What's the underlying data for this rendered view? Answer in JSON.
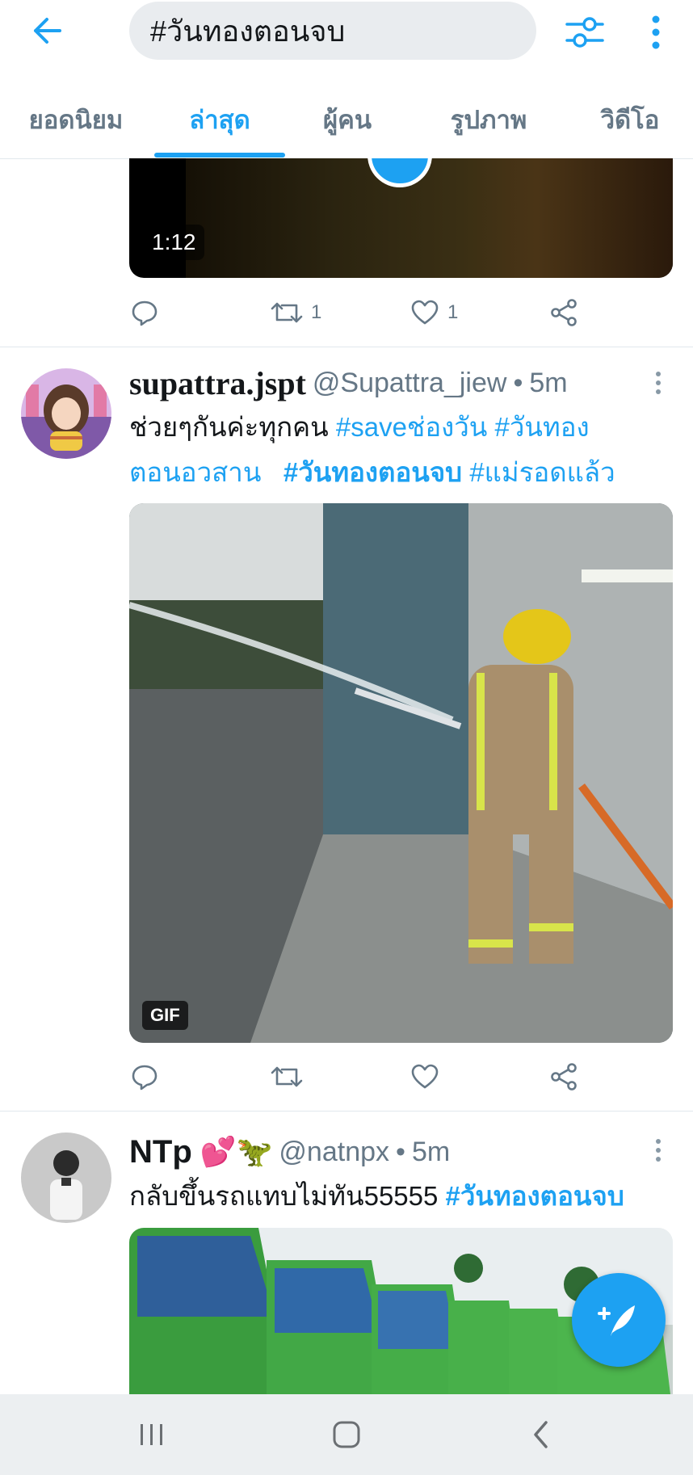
{
  "search": {
    "query": "#วันทองตอนจบ"
  },
  "tabs": [
    {
      "label": "ยอดนิยม"
    },
    {
      "label": "ล่าสุด"
    },
    {
      "label": "ผู้คน"
    },
    {
      "label": "รูปภาพ"
    },
    {
      "label": "วิดีโอ"
    }
  ],
  "active_tab": "ล่าสุด",
  "tweet1": {
    "video_duration": "1:12",
    "retweets": "1",
    "likes": "1"
  },
  "tweet2": {
    "display_name": "supattra.jspt",
    "handle": "@Supattra_jiew",
    "time": "5m",
    "text_plain": "ช่วยๆกันค่ะทุกคน",
    "hashtags": [
      "#saveช่องวัน",
      "#วันทอง",
      "ตอนอวสาน",
      "#วันทองตอนจบ",
      "#แม่รอดแล้ว"
    ],
    "media_badge": "GIF"
  },
  "tweet3": {
    "display_name": "NTp",
    "emoji": "💕🦖",
    "handle": "@natnpx",
    "time": "5m",
    "text_plain": "กลับขึ้นรถแทบไม่ทัน55555",
    "hashtag": "#วันทองตอนจบ"
  },
  "separator": "•",
  "colors": {
    "accent": "#1da1f2",
    "secondary_text": "#657786",
    "divider": "#e1e8ed"
  }
}
